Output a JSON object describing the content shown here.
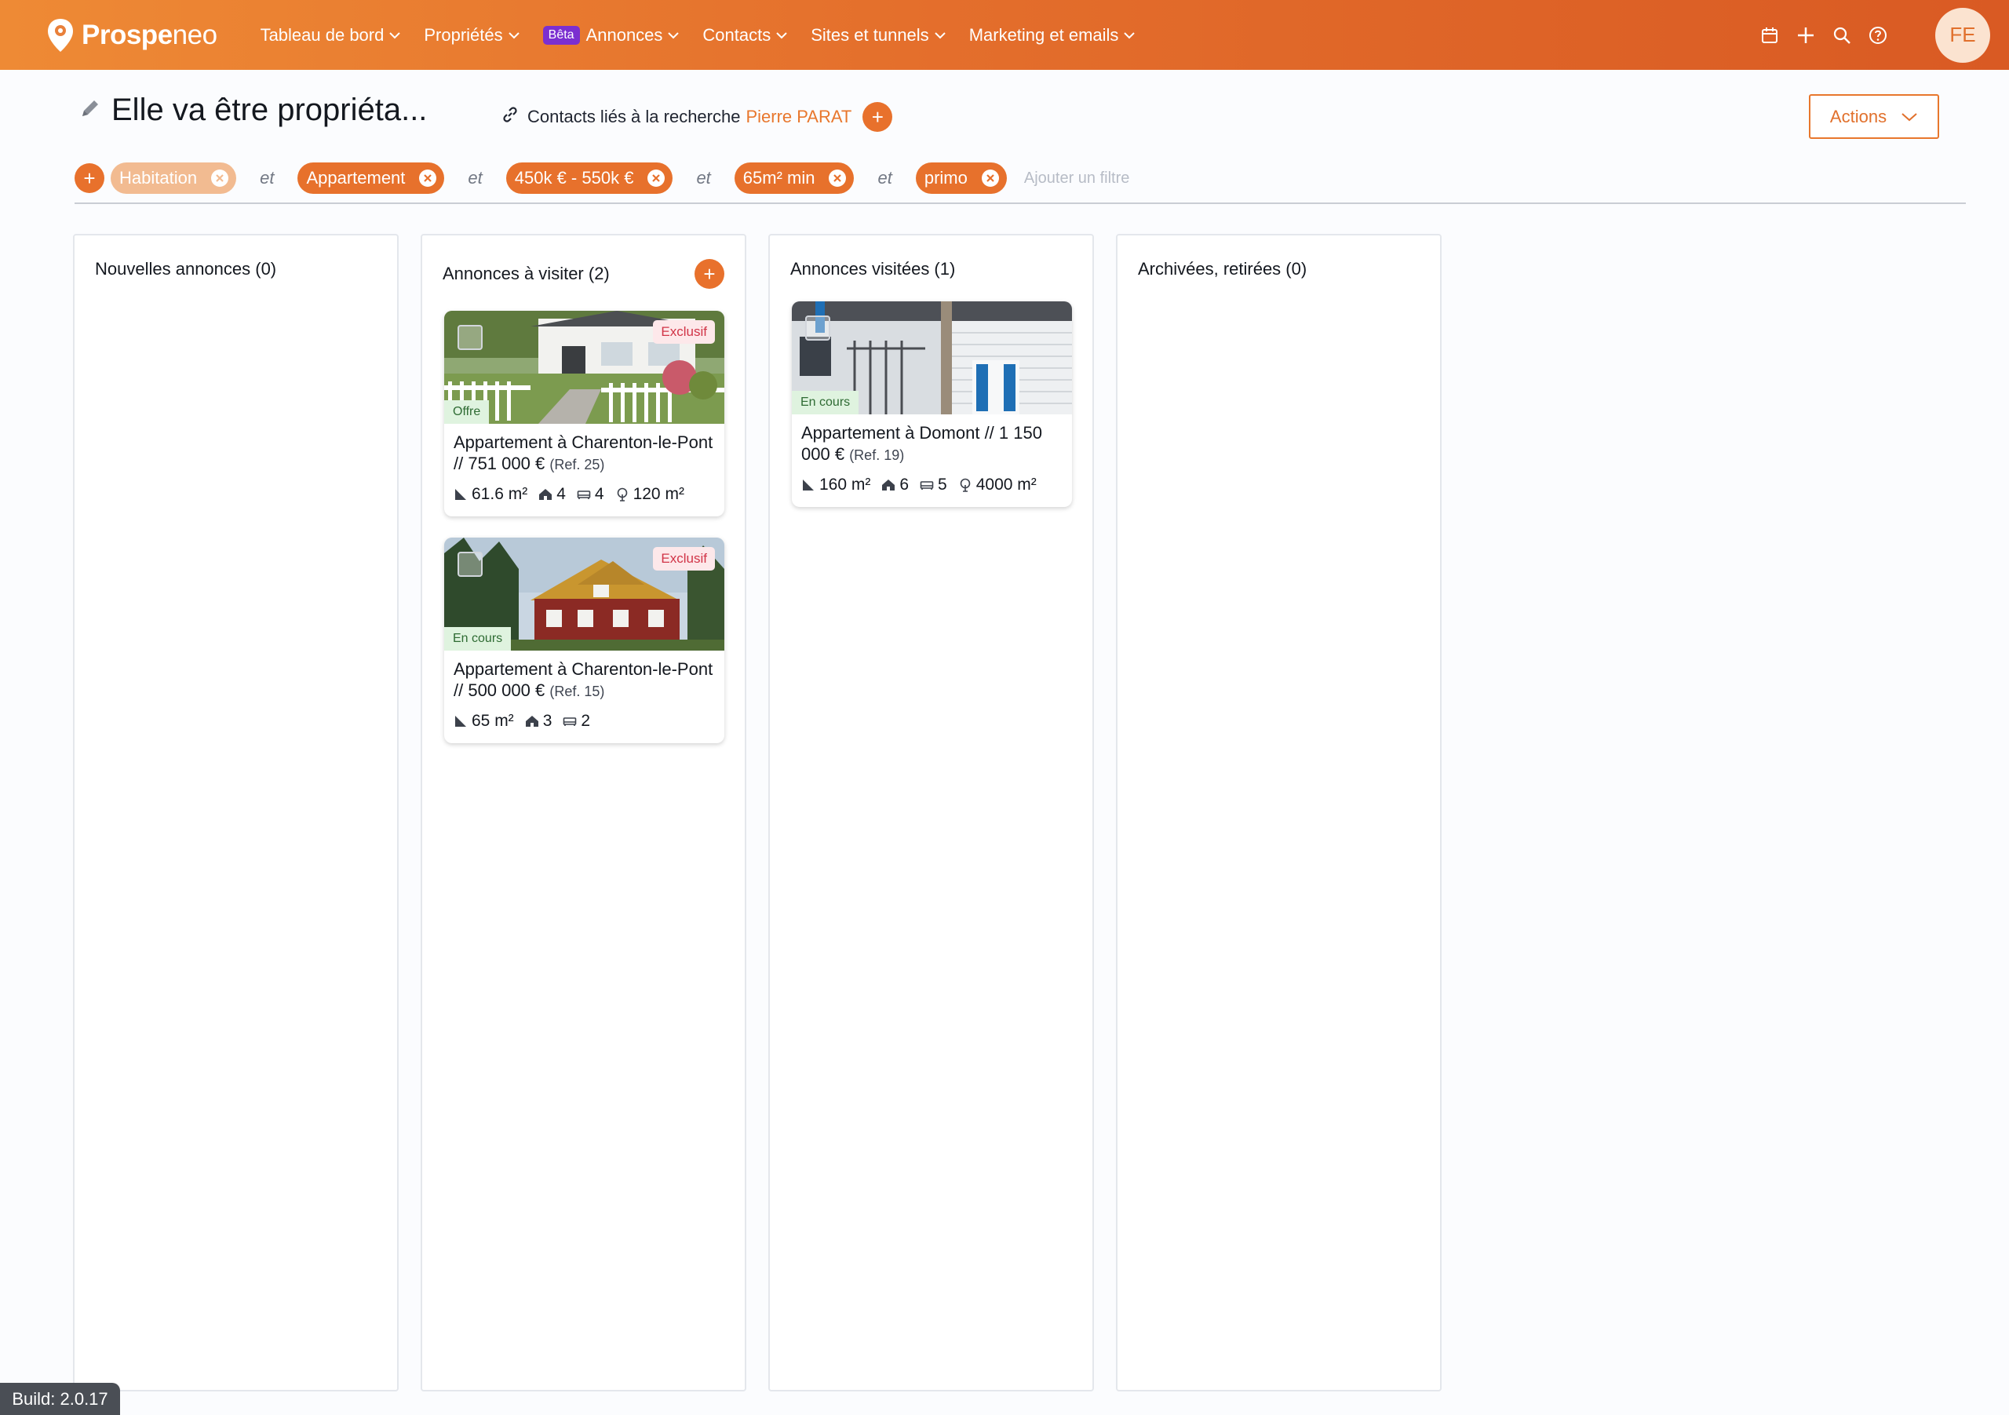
{
  "brand": {
    "name_bold": "Prospe",
    "name_light": "neo"
  },
  "nav": [
    {
      "label": "Tableau de bord",
      "beta": ""
    },
    {
      "label": "Propriétés",
      "beta": ""
    },
    {
      "label": "Annonces",
      "beta": "Bêta"
    },
    {
      "label": "Contacts",
      "beta": ""
    },
    {
      "label": "Sites et tunnels",
      "beta": ""
    },
    {
      "label": "Marketing et emails",
      "beta": ""
    }
  ],
  "user": {
    "initials": "FE"
  },
  "header": {
    "title": "Elle va être propriéta...",
    "contacts_label": "Contacts liés à la recherche",
    "contact_name": "Pierre PARAT",
    "actions_label": "Actions"
  },
  "filters": {
    "chips": [
      "Habitation",
      "Appartement",
      "450k € - 550k €",
      "65m² min",
      "primo"
    ],
    "joiner": "et",
    "add_placeholder": "Ajouter un filtre"
  },
  "columns": [
    {
      "title": "Nouvelles annonces (0)"
    },
    {
      "title": "Annonces à visiter (2)"
    },
    {
      "title": "Annonces visitées (1)"
    },
    {
      "title": "Archivées, retirées (0)"
    }
  ],
  "cards": {
    "c1": {
      "exclusive": "Exclusif",
      "status": "Offre",
      "title": "Appartement à Charenton-le-Pont // 751 000 €",
      "ref": "(Ref. 25)",
      "surface": "61.6 m²",
      "rooms": "4",
      "bedrooms": "4",
      "land": "120 m²"
    },
    "c2": {
      "exclusive": "Exclusif",
      "status": "En cours",
      "title": "Appartement à Charenton-le-Pont // 500 000 €",
      "ref": "(Ref. 15)",
      "surface": "65 m²",
      "rooms": "3",
      "bedrooms": "2"
    },
    "c3": {
      "status": "En cours",
      "title": "Appartement à Domont // 1 150 000 €",
      "ref": "(Ref. 19)",
      "surface": "160 m²",
      "rooms": "6",
      "bedrooms": "5",
      "land": "4000 m²"
    }
  },
  "build": "Build: 2.0.17",
  "colors": {
    "accent": "#e8712c",
    "nav_gradient_start": "#ee8a35",
    "nav_gradient_end": "#d95a23"
  }
}
